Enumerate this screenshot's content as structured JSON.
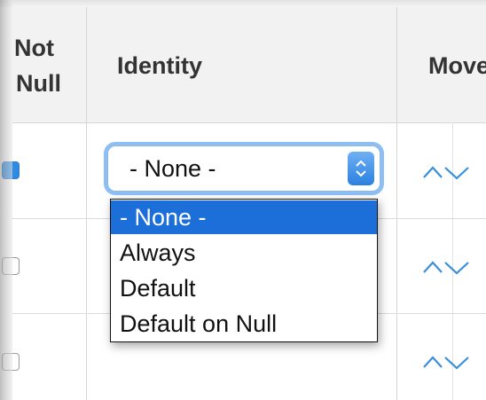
{
  "table": {
    "columns": {
      "not_null": "Not\nNull",
      "not_null_line1": "Not",
      "not_null_line2": "Null",
      "identity": "Identity",
      "move": "Move"
    },
    "rows": [
      {
        "not_null_checked": true
      },
      {
        "not_null_checked": false
      },
      {
        "not_null_checked": false
      }
    ]
  },
  "identity_select": {
    "value": "- None -",
    "options": [
      "- None -",
      "Always",
      "Default",
      "Default on Null"
    ],
    "selected_index": 0
  },
  "colors": {
    "selection_blue": "#1c6ed8",
    "focus_ring": "#8cc0f5",
    "chevron_blue": "#3a8fd9",
    "header_bg": "#f2f2f2"
  },
  "icons": {
    "move_up": "chevron-up-icon",
    "move_down": "chevron-down-icon",
    "select_arrows": "up-down-arrows-icon"
  }
}
